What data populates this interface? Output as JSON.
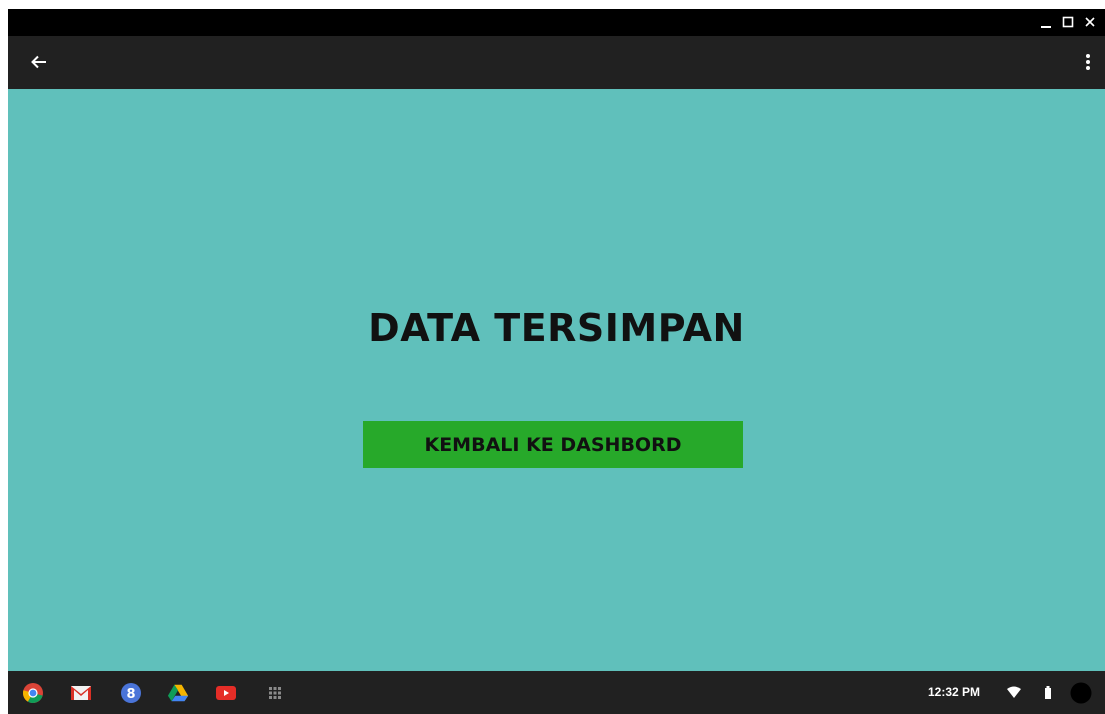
{
  "window": {
    "controls": [
      "minimize-icon",
      "maximize-icon",
      "close-icon"
    ]
  },
  "appbar": {
    "back_icon": "arrow-left-icon",
    "menu_icon": "more-vertical-icon"
  },
  "main": {
    "title": "DATA TERSIMPAN",
    "button_label": "KEMBALI KE DASHBORD"
  },
  "taskbar": {
    "apps": [
      "chrome-icon",
      "gmail-icon",
      "google-plus-icon",
      "drive-icon",
      "youtube-icon",
      "app-launcher-icon"
    ],
    "clock": "12:32 PM",
    "tray_icons": [
      "wifi-icon",
      "battery-icon",
      "user-avatar"
    ]
  },
  "colors": {
    "content_bg": "#60c0bb",
    "button_bg": "#27a92a",
    "bar_bg": "#212121",
    "titlebar_bg": "#000000"
  }
}
